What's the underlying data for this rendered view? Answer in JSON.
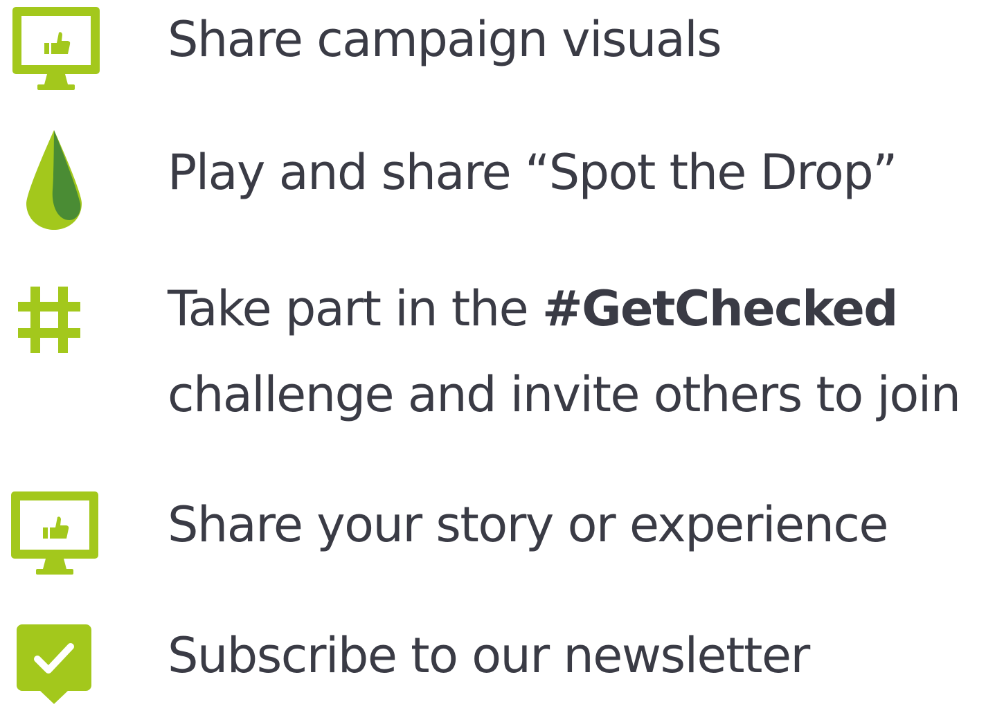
{
  "colors": {
    "accent_green": "#a3c81c",
    "dark_green": "#4a8c34",
    "text": "#3a3b45"
  },
  "items": [
    {
      "icon": "monitor-thumbs-up-icon",
      "text": "Share campaign visuals"
    },
    {
      "icon": "drop-icon",
      "text": "Play and share “Spot the Drop”"
    },
    {
      "icon": "hashtag-icon",
      "text_before": "Take part in the ",
      "text_bold": "#GetChecked",
      "text_line2": "challenge and invite others to join"
    },
    {
      "icon": "monitor-thumbs-up-icon",
      "text": "Share your story or experience"
    },
    {
      "icon": "checkmark-badge-icon",
      "text": "Subscribe to our newsletter"
    }
  ]
}
